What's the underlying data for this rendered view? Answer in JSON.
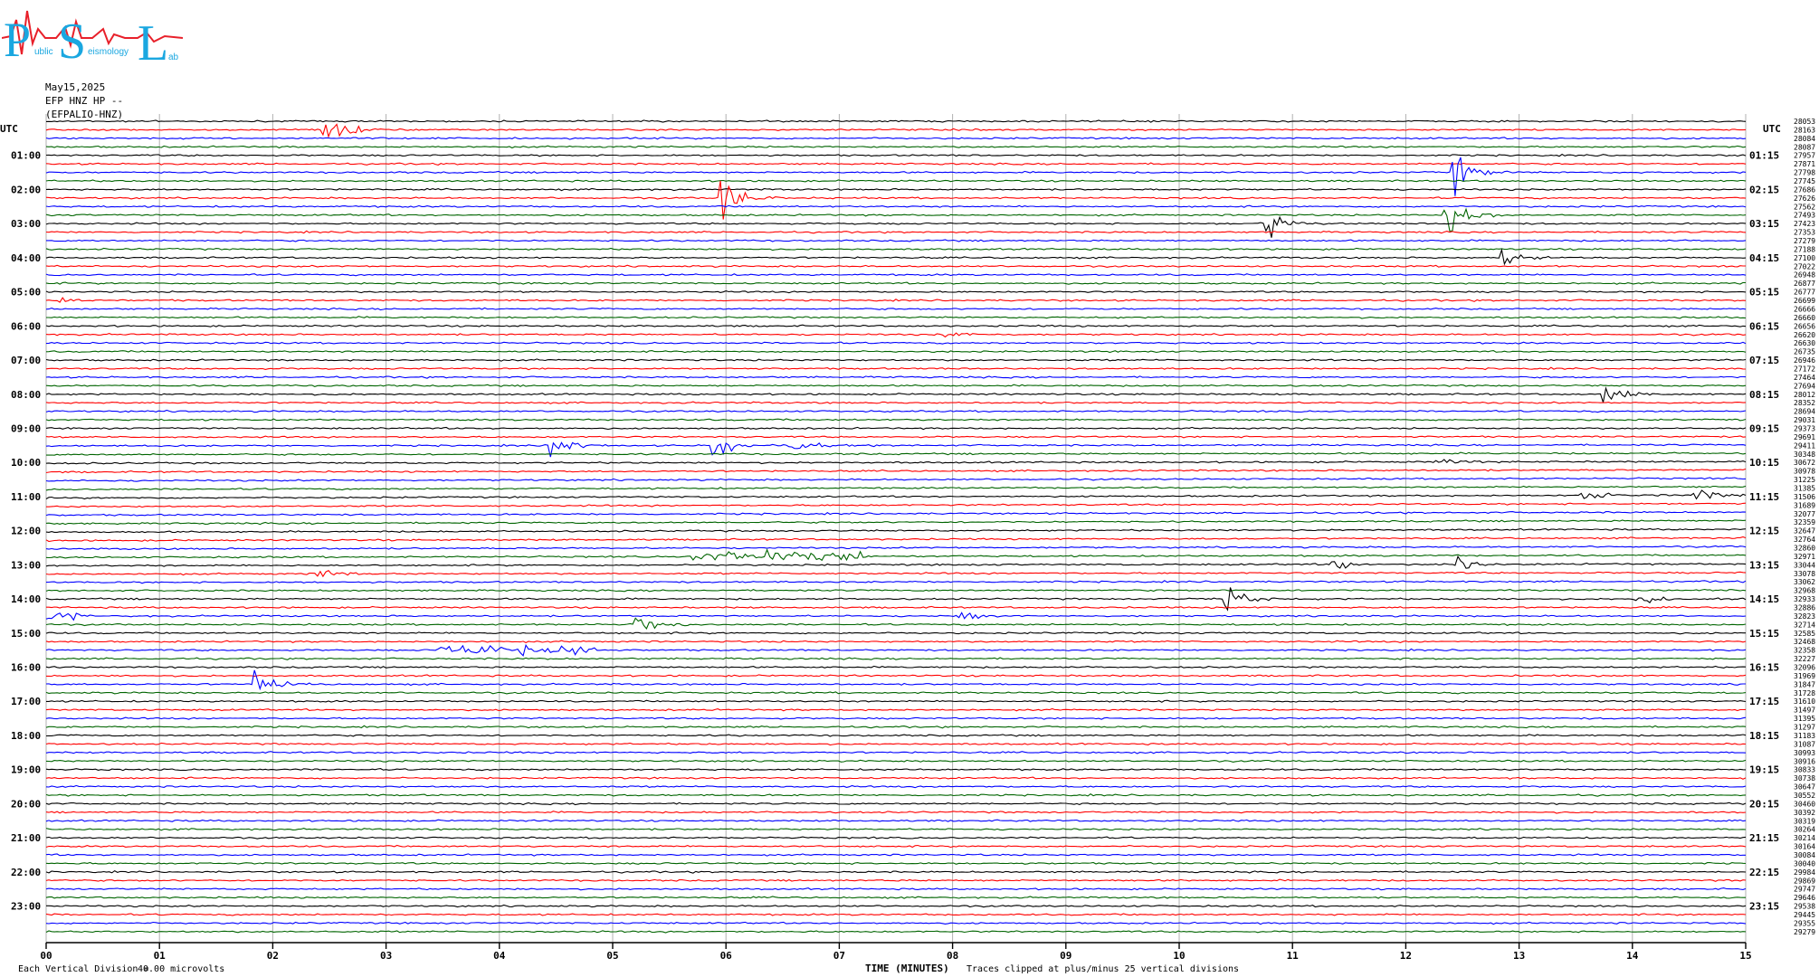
{
  "header": {
    "logo_letters": [
      "P",
      "S",
      "L"
    ],
    "logo_words": [
      "ublic",
      "eismology",
      "ab"
    ],
    "date": "May15,2025",
    "station": "EFP HNZ HP --",
    "code": "(EFPALIO-HNZ)",
    "utc_label": "UTC"
  },
  "footer": {
    "division_label": "Each Vertical Division =",
    "division_value": "40.00 microvolts",
    "xlabel": "TIME (MINUTES)",
    "clip_note": "Traces clipped at plus/minus 25 vertical divisions"
  },
  "colors": {
    "cycle": [
      "#000000",
      "#ff0000",
      "#0000ff",
      "#006400"
    ],
    "grid": "#b0b0b0",
    "logo_blue": "#1aa7e0",
    "logo_red": "#e8202a"
  },
  "chart_data": {
    "type": "line",
    "title": "May15,2025",
    "xlabel": "TIME (MINUTES)",
    "xlim": [
      0,
      15
    ],
    "x_ticks": [
      "00",
      "01",
      "02",
      "03",
      "04",
      "05",
      "06",
      "07",
      "08",
      "09",
      "10",
      "11",
      "12",
      "13",
      "14",
      "15"
    ],
    "left_hour_labels": [
      "01:00",
      "02:00",
      "03:00",
      "04:00",
      "05:00",
      "06:00",
      "07:00",
      "08:00",
      "09:00",
      "10:00",
      "11:00",
      "12:00",
      "13:00",
      "14:00",
      "15:00",
      "16:00",
      "17:00",
      "18:00",
      "19:00",
      "20:00",
      "21:00",
      "22:00",
      "23:00"
    ],
    "right_hour_labels": [
      "01:15",
      "02:15",
      "03:15",
      "04:15",
      "05:15",
      "06:15",
      "07:15",
      "08:15",
      "09:15",
      "10:15",
      "11:15",
      "12:15",
      "13:15",
      "14:15",
      "15:15",
      "16:15",
      "17:15",
      "18:15",
      "19:15",
      "20:15",
      "21:15",
      "22:15",
      "23:15"
    ],
    "traces_per_hour": 4,
    "trace_count": 96,
    "trace_values": [
      28053,
      28163,
      28084,
      28087,
      27957,
      27871,
      27798,
      27745,
      27686,
      27626,
      27562,
      27493,
      27423,
      27353,
      27279,
      27188,
      27100,
      27022,
      26948,
      26877,
      26777,
      26699,
      26666,
      26660,
      26656,
      26620,
      26630,
      26735,
      26946,
      27172,
      27464,
      27694,
      28012,
      28352,
      28694,
      29031,
      29373,
      29691,
      29411,
      30348,
      30672,
      30978,
      31225,
      31385,
      31506,
      31689,
      32077,
      32359,
      32647,
      32764,
      32860,
      32971,
      33044,
      33078,
      33062,
      32968,
      32933,
      32886,
      32823,
      32714,
      32585,
      32468,
      32358,
      32227,
      32096,
      31969,
      31847,
      31728,
      31610,
      31497,
      31395,
      31297,
      31183,
      31087,
      30993,
      30916,
      30833,
      30738,
      30647,
      30552,
      30460,
      30392,
      30319,
      30264,
      30214,
      30164,
      30084,
      30040,
      29984,
      29869,
      29747,
      29646,
      29538,
      29445,
      29355,
      29279
    ],
    "events": [
      {
        "minute": 2.45,
        "trace": 1,
        "amplitude_div": 25
      },
      {
        "minute": 5.95,
        "trace": 9,
        "amplitude_div": 25
      },
      {
        "minute": 10.72,
        "trace": 12,
        "amplitude_div": 25
      },
      {
        "minute": 12.35,
        "trace": 11,
        "amplitude_div": 25
      },
      {
        "minute": 12.42,
        "trace": 6,
        "amplitude_div": 20
      },
      {
        "minute": 12.85,
        "trace": 16,
        "amplitude_div": 12
      },
      {
        "minute": 7.92,
        "trace": 25,
        "amplitude_div": 6
      },
      {
        "minute": 0.12,
        "trace": 21,
        "amplitude_div": 5
      },
      {
        "minute": 4.45,
        "trace": 38,
        "amplitude_div": 14
      },
      {
        "minute": 5.88,
        "trace": 38,
        "amplitude_div": 14
      },
      {
        "minute": 6.55,
        "trace": 38,
        "amplitude_div": 12
      },
      {
        "minute": 13.75,
        "trace": 32,
        "amplitude_div": 12
      },
      {
        "minute": 12.28,
        "trace": 40,
        "amplitude_div": 7
      },
      {
        "minute": 13.55,
        "trace": 44,
        "amplitude_div": 8
      },
      {
        "minute": 14.55,
        "trace": 44,
        "amplitude_div": 10
      },
      {
        "minute": 2.4,
        "trace": 53,
        "amplitude_div": 6
      },
      {
        "minute": 10.4,
        "trace": 56,
        "amplitude_div": 18
      },
      {
        "minute": 11.35,
        "trace": 52,
        "amplitude_div": 8
      },
      {
        "minute": 12.45,
        "trace": 52,
        "amplitude_div": 12
      },
      {
        "minute": 14.0,
        "trace": 56,
        "amplitude_div": 12
      },
      {
        "minute": 8.0,
        "trace": 58,
        "amplitude_div": 10
      },
      {
        "minute": 5.2,
        "trace": 59,
        "amplitude_div": 10
      },
      {
        "minute": 1.83,
        "trace": 66,
        "amplitude_div": 14
      }
    ],
    "noisy_segments": [
      {
        "trace": 62,
        "from_minute": 3.45,
        "to_minute": 4.9
      },
      {
        "trace": 51,
        "from_minute": 5.7,
        "to_minute": 7.3
      },
      {
        "trace": 58,
        "from_minute": 0.0,
        "to_minute": 0.3
      }
    ]
  }
}
